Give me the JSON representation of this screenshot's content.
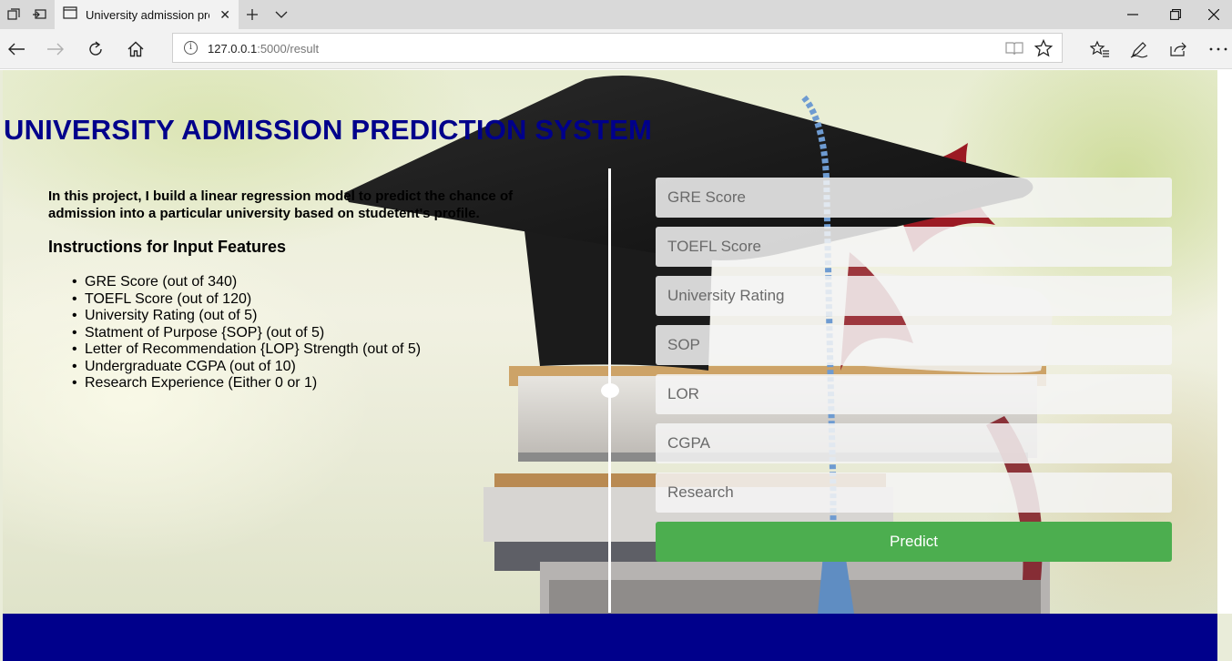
{
  "browser": {
    "tab_title": "University admission prediction",
    "url_host": "127.0.0.1",
    "url_path": ":5000/result",
    "icons": [
      "tab-manager-icon",
      "set-aside-tabs-icon",
      "page-icon",
      "close-icon",
      "new-tab-icon",
      "chevron-down-icon",
      "minimize-icon",
      "restore-icon",
      "close-window-icon",
      "back-icon",
      "forward-icon",
      "refresh-icon",
      "home-icon",
      "info-icon",
      "reading-view-icon",
      "favorite-star-icon",
      "favorites-icon",
      "pen-icon",
      "share-icon",
      "more-icon"
    ]
  },
  "page": {
    "title": "UNIVERSITY ADMISSION PREDICTION SYSTEM",
    "intro": "In this project, I build a linear regression model to predict the chance of admission into a particular university based on studetent's profile.",
    "instructions_heading": "Instructions for Input Features",
    "features": [
      "GRE Score (out of 340)",
      "TOEFL Score (out of 120)",
      "University Rating (out of 5)",
      "Statment of Purpose {SOP} (out of 5)",
      "Letter of Recommendation {LOP} Strength (out of 5)",
      "Undergraduate CGPA (out of 10)",
      "Research Experience (Either 0 or 1)"
    ]
  },
  "form": {
    "gre_placeholder": "GRE Score",
    "toefl_placeholder": "TOEFL Score",
    "rating_placeholder": "University Rating",
    "sop_placeholder": "SOP",
    "lor_placeholder": "LOR",
    "cgpa_placeholder": "CGPA",
    "research_placeholder": "Research",
    "predict_label": "Predict"
  },
  "colors": {
    "title": "#00008b",
    "footer": "#00008b",
    "predict_button": "#4cae4f"
  }
}
